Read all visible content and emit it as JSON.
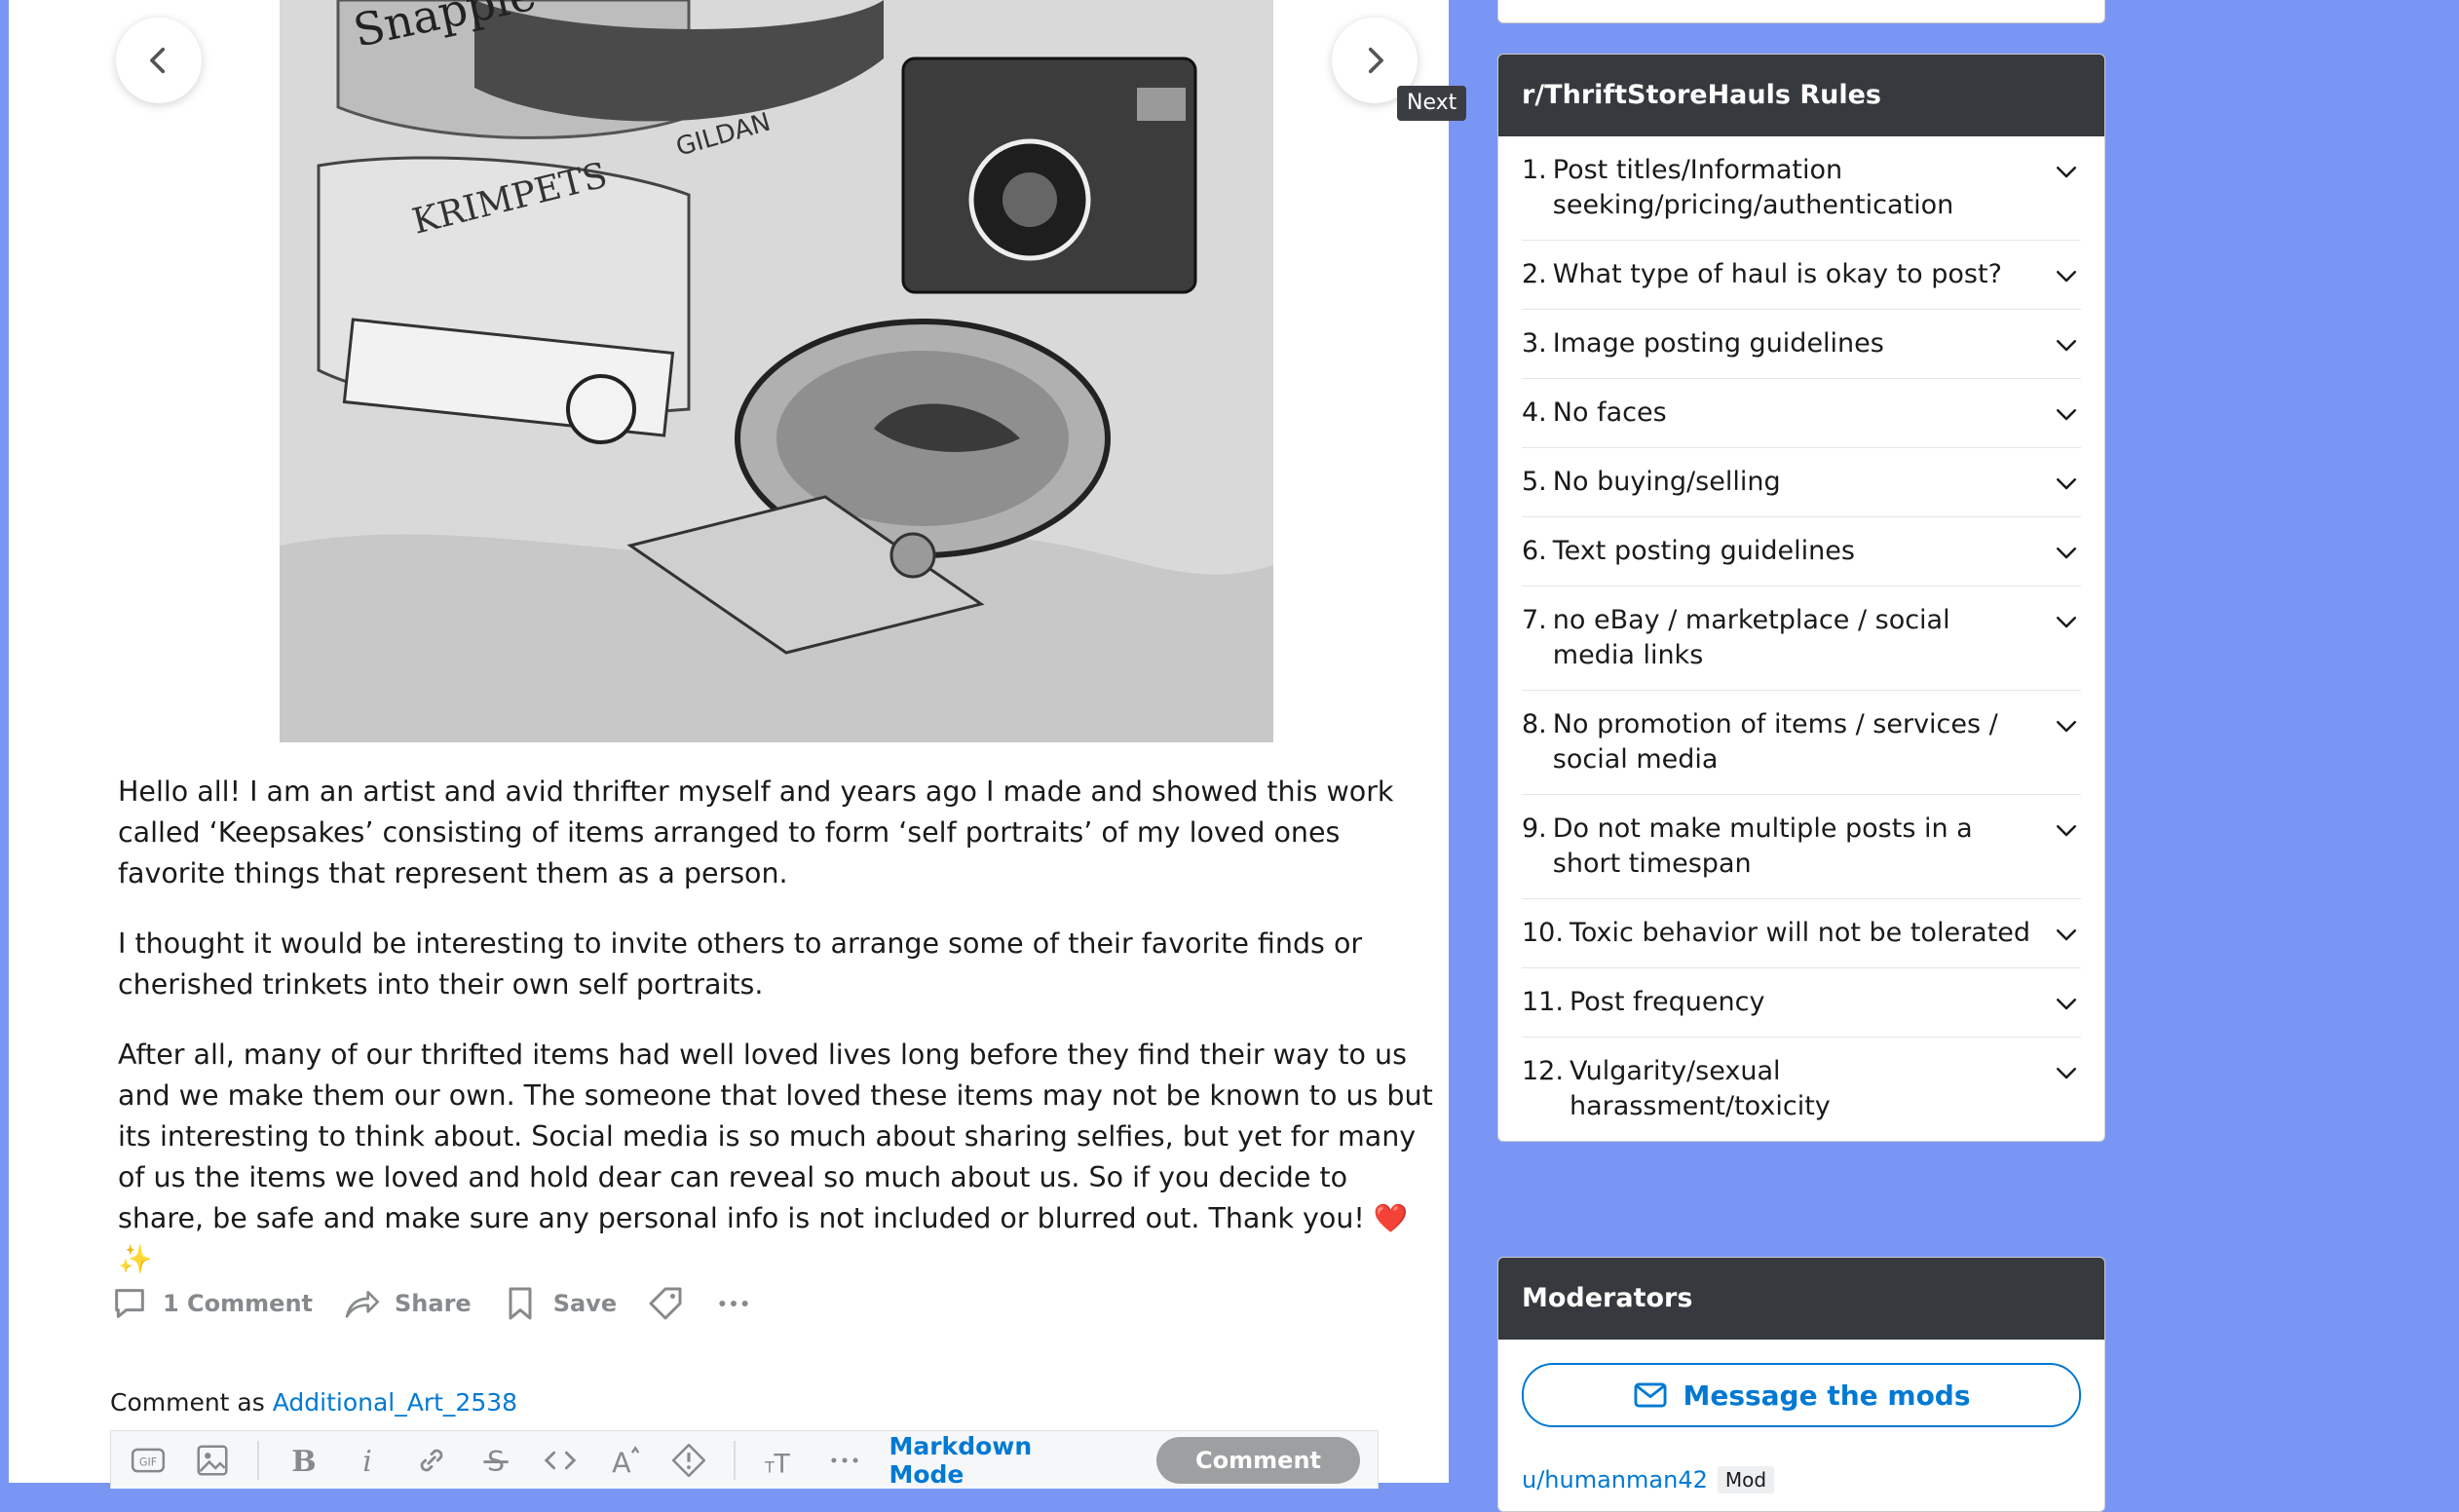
{
  "post": {
    "nav": {
      "next_tooltip": "Next"
    },
    "image_text": {
      "snapple": "Snapple",
      "krimpets": "KRIMPETS",
      "gildan": "GILDAN"
    },
    "body": [
      "Hello all! I am an artist and avid thrifter myself and years ago I made and showed this work called ‘Keepsakes’ consisting of items arranged to form ‘self portraits’ of my loved ones favorite things that represent them as a person.",
      "I thought it would be interesting to invite others to arrange some of their favorite finds or cherished trinkets into their own self portraits.",
      "After all, many of our thrifted items had well loved lives long before they find their way to us and we make them our own. The someone that loved these items may not be known to us but its interesting to think about. Social media is so much about sharing selfies, but yet for many of us the items we loved and hold dear can reveal so much about us. So if you decide to share, be safe and make sure any personal info is not included or blurred out. Thank you! ❤️✨"
    ],
    "actions": {
      "comments": "1 Comment",
      "share": "Share",
      "save": "Save"
    }
  },
  "comment_box": {
    "comment_as_label": "Comment as",
    "username": "Additional_Art_2538",
    "markdown_mode": "Markdown Mode",
    "submit": "Comment"
  },
  "sidebar": {
    "rules_title": "r/ThriftStoreHauls Rules",
    "rules": [
      {
        "num": "1.",
        "text": "Post titles/Information seeking/pricing/authentication"
      },
      {
        "num": "2.",
        "text": "What type of haul is okay to post?"
      },
      {
        "num": "3.",
        "text": "Image posting guidelines"
      },
      {
        "num": "4.",
        "text": "No faces"
      },
      {
        "num": "5.",
        "text": "No buying/selling"
      },
      {
        "num": "6.",
        "text": "Text posting guidelines"
      },
      {
        "num": "7.",
        "text": "no eBay / marketplace / social media links"
      },
      {
        "num": "8.",
        "text": "No promotion of items / services / social media"
      },
      {
        "num": "9.",
        "text": "Do not make multiple posts in a short timespan"
      },
      {
        "num": "10.",
        "text": "Toxic behavior will not be tolerated"
      },
      {
        "num": "11.",
        "text": "Post frequency"
      },
      {
        "num": "12.",
        "text": "Vulgarity/sexual harassment/toxicity"
      }
    ],
    "moderators_title": "Moderators",
    "message_mods": "Message the mods",
    "first_mod": {
      "name": "u/humanman42",
      "badge": "Mod"
    }
  },
  "colors": {
    "background": "#7a96f4",
    "link": "#0079d3",
    "card_header": "#36393d",
    "muted": "#878a8c"
  }
}
